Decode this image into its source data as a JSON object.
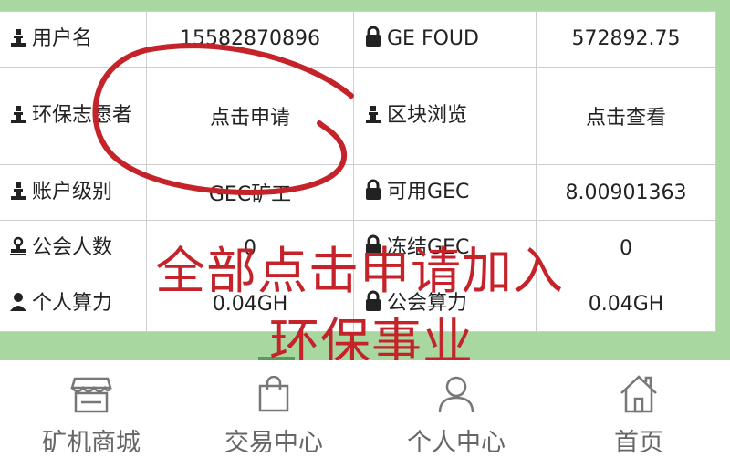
{
  "table": {
    "rows": [
      {
        "left_icon": "chess-piece-icon",
        "left_label": "用户名",
        "left_value": "15582870896",
        "right_icon": "lock-icon",
        "right_label": "GE FOUD",
        "right_value": "572892.75"
      },
      {
        "left_icon": "chess-piece-icon",
        "left_label": "环保志愿者",
        "left_value": "点击申请",
        "right_icon": "chess-piece-icon",
        "right_label": "区块浏览",
        "right_value": "点击查看"
      },
      {
        "left_icon": "chess-piece-icon",
        "left_label": "账户级别",
        "left_value": "GEC矿工",
        "right_icon": "lock-icon",
        "right_label": "可用GEC",
        "right_value": "8.00901363"
      },
      {
        "left_icon": "stamp-icon",
        "left_label": "公会人数",
        "left_value": "0",
        "right_icon": "lock-icon",
        "right_label": "冻结GEC",
        "right_value": "0"
      },
      {
        "left_icon": "person-icon",
        "left_label": "个人算力",
        "left_value": "0.04GH",
        "right_icon": "lock-icon",
        "right_label": "公会算力",
        "right_value": "0.04GH"
      }
    ]
  },
  "overlay": {
    "line1": "全部点击申请加入",
    "line2": "环保事业"
  },
  "nav": {
    "items": [
      {
        "label": "矿机商城",
        "icon": "store-icon"
      },
      {
        "label": "交易中心",
        "icon": "shopping-bag-icon"
      },
      {
        "label": "个人中心",
        "icon": "user-icon"
      },
      {
        "label": "首页",
        "icon": "home-icon"
      }
    ]
  },
  "colors": {
    "link": "#15a06b",
    "annotation": "#c5232a",
    "background": "#a8d8a0"
  }
}
